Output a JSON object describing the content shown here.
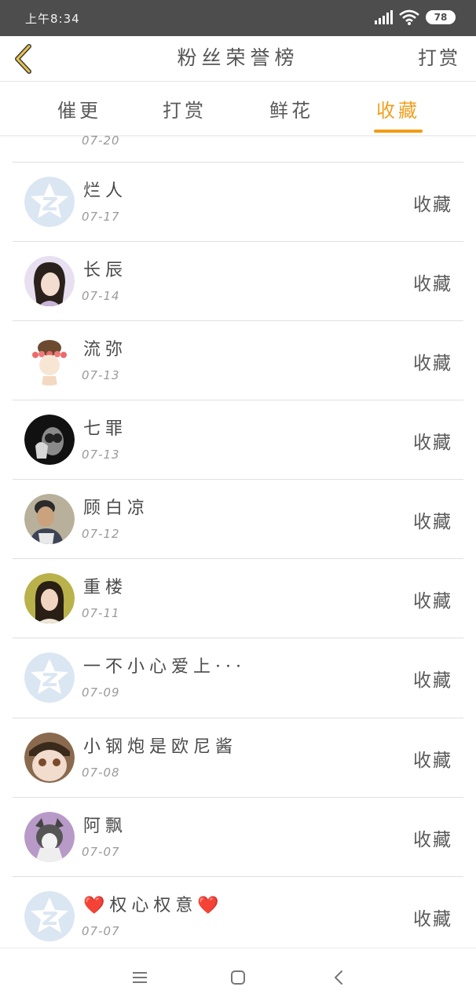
{
  "status": {
    "time": "上午8:34",
    "battery": "78"
  },
  "header": {
    "title": "粉丝荣誉榜",
    "right_action": "打赏"
  },
  "tabs": [
    {
      "label": "催更",
      "active": false
    },
    {
      "label": "打赏",
      "active": false
    },
    {
      "label": "鲜花",
      "active": false
    },
    {
      "label": "收藏",
      "active": true
    }
  ],
  "accent_color": "#f39c12",
  "partial_row": {
    "date": "07-20"
  },
  "rows": [
    {
      "name": "烂人",
      "date": "07-17",
      "action": "收藏",
      "avatar": "default-avatar-icon"
    },
    {
      "name": "长辰",
      "date": "07-14",
      "action": "收藏",
      "avatar": "user-avatar"
    },
    {
      "name": "流弥",
      "date": "07-13",
      "action": "收藏",
      "avatar": "user-avatar"
    },
    {
      "name": "七罪",
      "date": "07-13",
      "action": "收藏",
      "avatar": "user-avatar"
    },
    {
      "name": "顾白凉",
      "date": "07-12",
      "action": "收藏",
      "avatar": "user-avatar"
    },
    {
      "name": "重楼",
      "date": "07-11",
      "action": "收藏",
      "avatar": "user-avatar"
    },
    {
      "name": "一不小心爱上···",
      "date": "07-09",
      "action": "收藏",
      "avatar": "default-avatar-icon"
    },
    {
      "name": "小钢炮是欧尼酱",
      "date": "07-08",
      "action": "收藏",
      "avatar": "user-avatar"
    },
    {
      "name": "阿飘",
      "date": "07-07",
      "action": "收藏",
      "avatar": "user-avatar"
    },
    {
      "name": "❤️权心权意❤️",
      "date": "07-07",
      "action": "收藏",
      "avatar": "default-avatar-icon"
    }
  ]
}
